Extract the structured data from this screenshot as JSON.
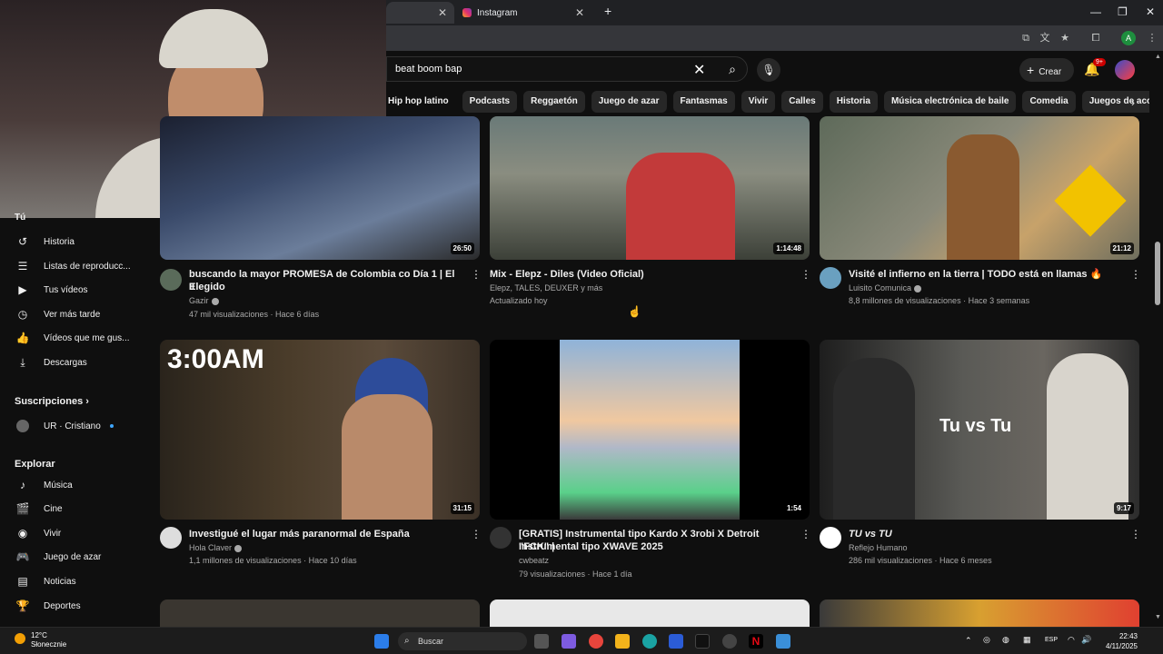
{
  "browser": {
    "tabs": [
      {
        "label": ""
      },
      {
        "label": "Instagram"
      }
    ],
    "new_tab": "+"
  },
  "yt": {
    "search_value": "beat boom bap",
    "create_label": "Crear",
    "notif_badge": "9+"
  },
  "chips": [
    "Hip hop latino",
    "Podcasts",
    "Reggaetón",
    "Juego de azar",
    "Fantasmas",
    "Vivir",
    "Calles",
    "Historia",
    "Música electrónica de baile",
    "Comedia",
    "Juegos de acción y aven"
  ],
  "sidebar": {
    "section_you": "Tú",
    "items": [
      {
        "label": "Historia",
        "icon": "history-icon"
      },
      {
        "label": "Listas de reproducc...",
        "icon": "playlists-icon"
      },
      {
        "label": "Tus vídeos",
        "icon": "your-videos-icon"
      },
      {
        "label": "Ver más tarde",
        "icon": "watch-later-icon"
      },
      {
        "label": "Vídeos que me gus...",
        "icon": "liked-icon"
      },
      {
        "label": "Descargas",
        "icon": "download-icon"
      }
    ],
    "subs_heading": "Suscripciones",
    "subs": [
      {
        "label": "UR · Cristiano"
      }
    ],
    "explore_heading": "Explorar",
    "explore": [
      {
        "label": "Música",
        "icon": "music-icon"
      },
      {
        "label": "Cine",
        "icon": "film-icon"
      },
      {
        "label": "Vivir",
        "icon": "live-icon"
      },
      {
        "label": "Juego de azar",
        "icon": "gaming-icon"
      },
      {
        "label": "Noticias",
        "icon": "news-icon"
      },
      {
        "label": "Deportes",
        "icon": "sports-icon"
      }
    ]
  },
  "videos": [
    {
      "title1": "buscando la mayor PROMESA de Colombia co Día 1 | El Elegido",
      "title2": "II",
      "channel": "Gazir",
      "meta": "47 mil visualizaciones · Hace 6 días",
      "duration": "26:50"
    },
    {
      "title1": "Mix - Elepz - Diles (Video Oficial)",
      "title2": "",
      "channel": "Elepz, TALES, DEUXER y más",
      "meta": "Actualizado hoy",
      "duration": "1:14:48"
    },
    {
      "title1": "Visité el infierno en la tierra | TODO está en llamas 🔥",
      "title2": "",
      "channel": "Luisito Comunica",
      "meta": "8,8 millones de visualizaciones · Hace 3 semanas",
      "duration": "21:12"
    },
    {
      "title1": "Investigué el lugar más paranormal de España",
      "title2": "",
      "channel": "Hola Claver",
      "meta": "1,1 millones de visualizaciones · Hace 10 días",
      "duration": "31:15",
      "thumb_text": "3:00AM"
    },
    {
      "title1": "[GRATIS] Instrumental tipo Kardo X 3robi X Detroit \"FCK\" |",
      "title2": "Instrumental tipo XWAVE 2025",
      "channel": "cwbeatz",
      "meta": "79 visualizaciones · Hace 1 día",
      "duration": "1:54"
    },
    {
      "title1": "TU vs TU",
      "title2": "",
      "channel": "Reflejo Humano",
      "meta": "286 mil visualizaciones · Hace 6 meses",
      "duration": "9:17",
      "thumb_text": "Tu vs Tu"
    }
  ],
  "taskbar": {
    "temp": "12°C",
    "weather": "Słonecznie",
    "search": "Buscar",
    "lang": "ESP",
    "time": "22:43",
    "date": "4/11/2025"
  },
  "colors": {
    "background": "#0f0f0f",
    "chip": "#272727",
    "accent_red": "#cc0000",
    "link_blue": "#3ea6ff"
  }
}
